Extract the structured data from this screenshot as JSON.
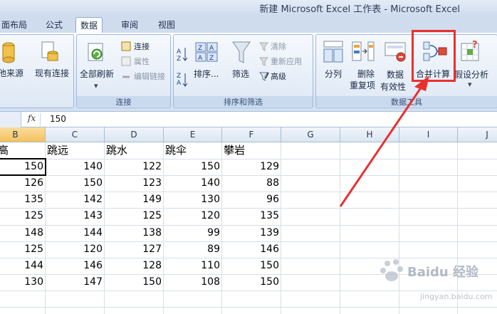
{
  "window": {
    "title": "新建 Microsoft Excel 工作表 - Microsoft Excel"
  },
  "tabs": [
    {
      "label": "面布局"
    },
    {
      "label": "公式"
    },
    {
      "label": "数据",
      "active": true
    },
    {
      "label": "审阅"
    },
    {
      "label": "视图"
    }
  ],
  "ribbon": {
    "get_external": {
      "other_sources": "他来源",
      "existing": "现有连接"
    },
    "connections": {
      "label": "连接",
      "refresh_all": "全部刷新",
      "conn": "连接",
      "props": "属性",
      "edit_links": "编辑链接"
    },
    "sort_filter": {
      "label": "排序和筛选",
      "sort": "排序...",
      "filter": "筛选",
      "clear": "清除",
      "reapply": "重新应用",
      "advanced": "高级"
    },
    "data_tools": {
      "label": "数据工具",
      "split": "分列",
      "remove_dup_1": "删除",
      "remove_dup_2": "重复项",
      "validation_1": "数据",
      "validation_2": "有效性",
      "consolidate": "合并计算",
      "whatif": "假设分析"
    }
  },
  "formula_bar": {
    "fx": "fx",
    "value": "150"
  },
  "columns": [
    "B",
    "C",
    "D",
    "E",
    "F",
    "G",
    "H",
    "I",
    "J"
  ],
  "sheet": {
    "headers": [
      "跳高",
      "跳远",
      "跳水",
      "跳伞",
      "攀岩"
    ],
    "rows": [
      [
        150,
        140,
        122,
        150,
        129
      ],
      [
        126,
        150,
        123,
        140,
        88
      ],
      [
        135,
        142,
        149,
        130,
        96
      ],
      [
        125,
        143,
        125,
        120,
        135
      ],
      [
        148,
        144,
        138,
        99,
        139
      ],
      [
        125,
        120,
        127,
        89,
        146
      ],
      [
        144,
        146,
        128,
        110,
        150
      ],
      [
        130,
        147,
        150,
        108,
        150
      ]
    ]
  },
  "watermark": {
    "brand": "Baidu 经验",
    "url": "jingyan.baidu.com"
  },
  "colors": {
    "highlight": "#e8312f",
    "accent": "#4a7cc0"
  }
}
